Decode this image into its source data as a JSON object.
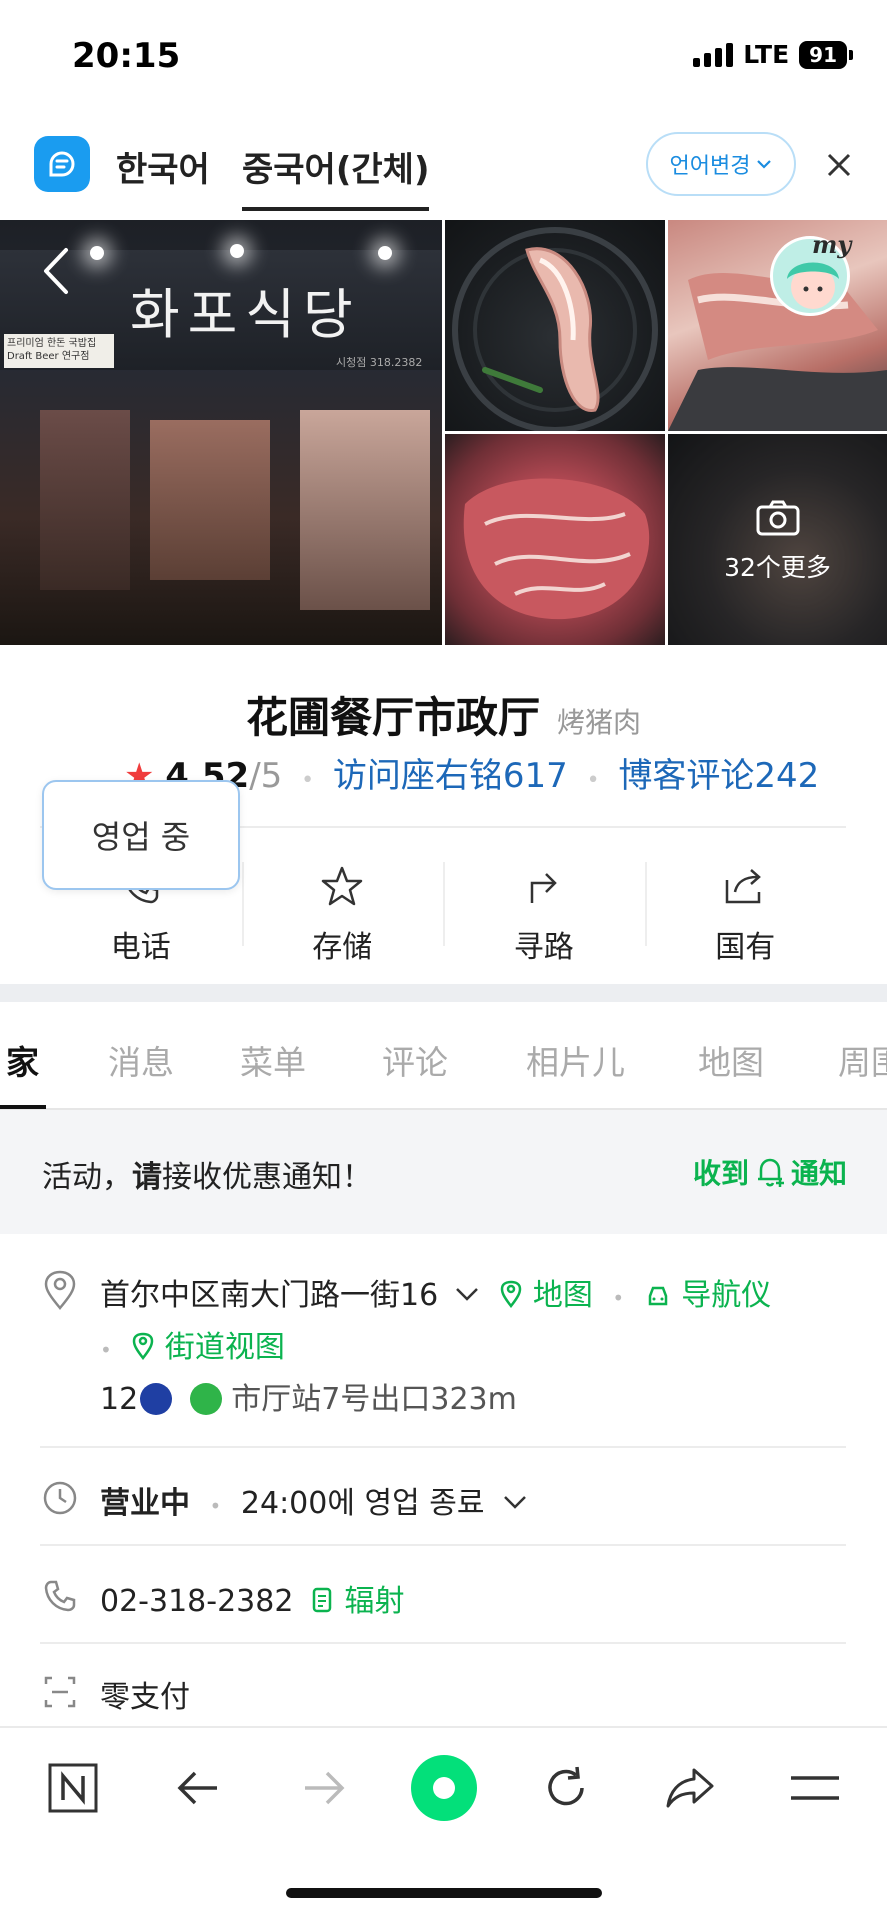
{
  "status_bar": {
    "time": "20:15",
    "network": "LTE",
    "battery": "91"
  },
  "translate_bar": {
    "lang_source": "한국어",
    "lang_target": "중국어(간체)",
    "change_label": "언어변경"
  },
  "gallery": {
    "sign_text": "화포식당",
    "sign_sub": "프리미엄 한돈 국밥집 Draft Beer 연구점",
    "sign_number": "시청점 318.2382",
    "more_label": "32个更多",
    "my_label": "my"
  },
  "place": {
    "name": "花圃餐厅市政厅",
    "category": "烤猪肉",
    "rating_star": "★",
    "rating_score": "4.52",
    "rating_of": "/5",
    "visitor_reviews": "访问座右铭617",
    "blog_reviews": "博客评论242"
  },
  "tooltip": {
    "text": "영업 중"
  },
  "actions": [
    {
      "label": "电话",
      "icon": "phone-icon"
    },
    {
      "label": "存储",
      "icon": "star-icon"
    },
    {
      "label": "寻路",
      "icon": "directions-icon"
    },
    {
      "label": "国有",
      "icon": "share-icon"
    }
  ],
  "tabs": [
    "家",
    "消息",
    "菜单",
    "评论",
    "相片儿",
    "地图",
    "周围"
  ],
  "promo": {
    "message_prefix": "活动，",
    "message_bold": "请",
    "message_suffix": "接收优惠通知！",
    "button_prefix": "收到",
    "button_suffix": "通知"
  },
  "address": {
    "text": "首尔中区南大门路一街16",
    "map_link": "地图",
    "nav_link": "导航仪",
    "street_view_link": "街道视图",
    "subway_lines": "12",
    "subway_text": "市厅站7号出口323m"
  },
  "hours": {
    "status": "营业中",
    "closing": "24:00에 영업 종료"
  },
  "phone": {
    "number": "02-318-2382",
    "copy_label": "辐射"
  },
  "payment": {
    "text": "零支付"
  },
  "colors": {
    "accent_green": "#0bb34f",
    "link_blue": "#1d68b8",
    "star_red": "#f03c3c",
    "subway_line1": "#1f3fa3",
    "subway_line2": "#2fb449",
    "naver_green": "#03e07a"
  }
}
